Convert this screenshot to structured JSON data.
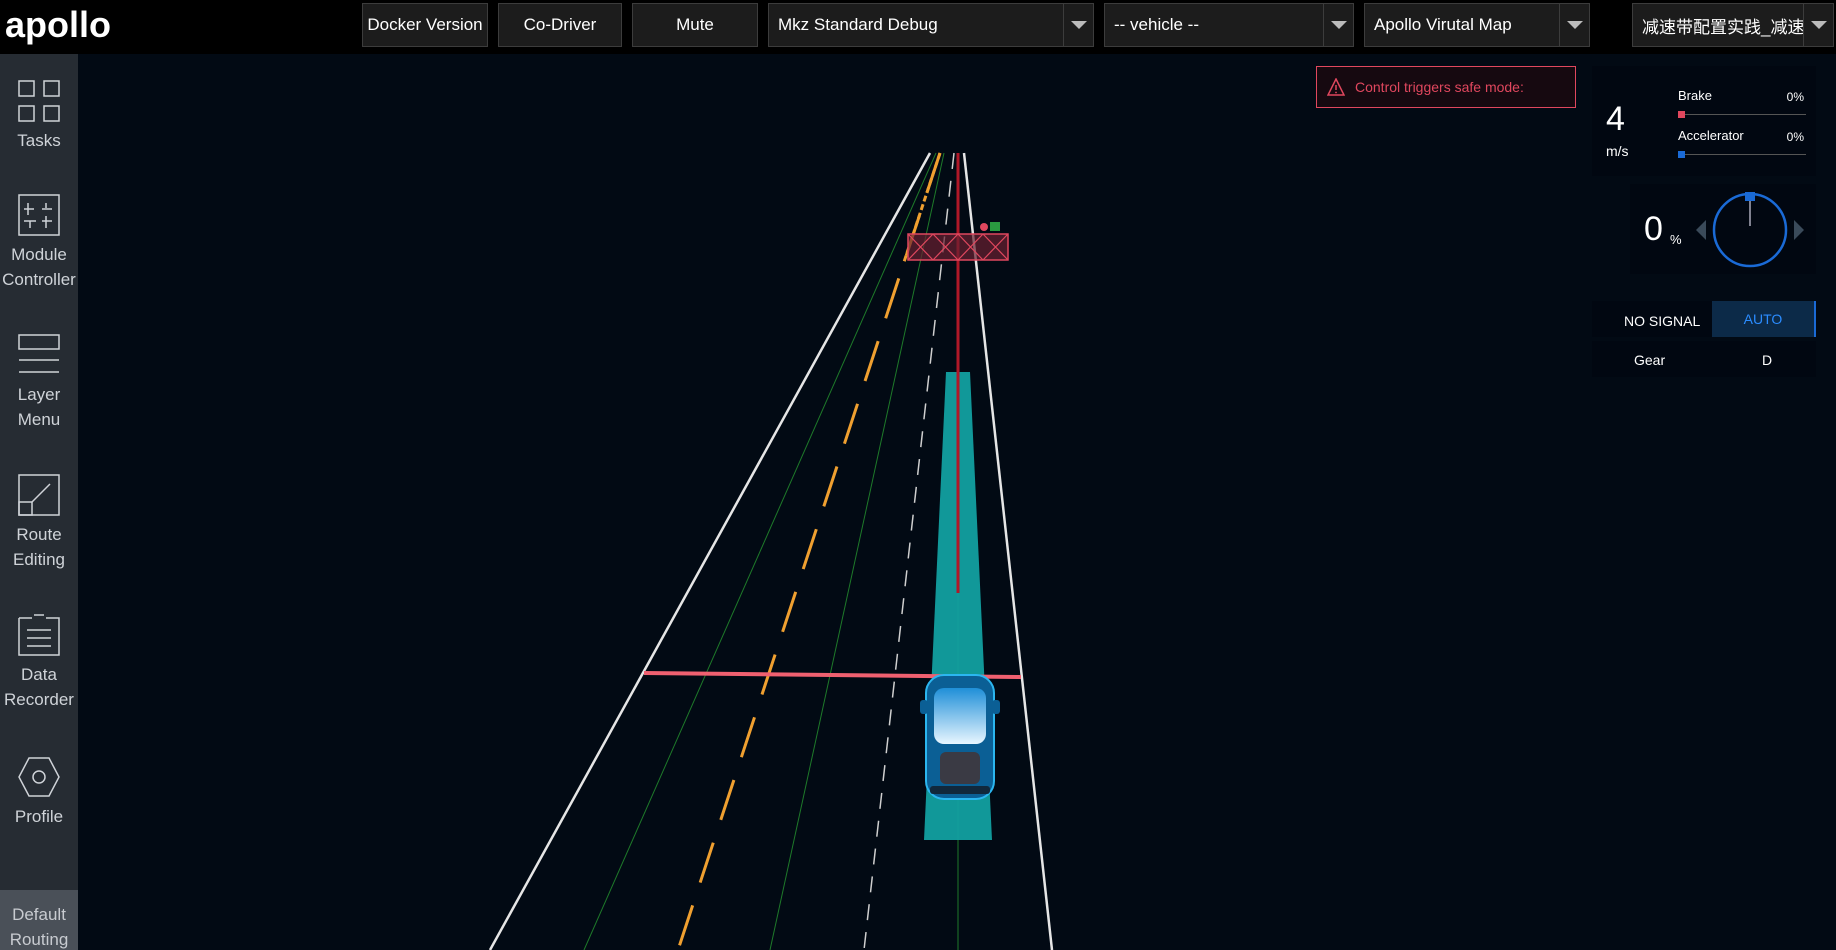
{
  "header": {
    "logo_text": "apollo",
    "buttons": {
      "docker_version": "Docker Version",
      "co_driver": "Co-Driver",
      "mute": "Mute"
    },
    "selects": {
      "mode": "Mkz Standard Debug",
      "vehicle": "-- vehicle --",
      "map": "Apollo Virutal Map",
      "scenario": "减速带配置实践_减速带"
    }
  },
  "sidebar": {
    "items": [
      {
        "label": "Tasks",
        "icon": "grid-icon"
      },
      {
        "label": "Module Controller",
        "icon": "sliders-icon"
      },
      {
        "label": "Layer Menu",
        "icon": "layers-icon"
      },
      {
        "label": "Route Editing",
        "icon": "route-icon"
      },
      {
        "label": "Data Recorder",
        "icon": "document-icon"
      },
      {
        "label": "Profile",
        "icon": "hexagon-icon"
      }
    ],
    "bottom_item": "Default Routing"
  },
  "alert": {
    "text": "Control triggers safe mode:",
    "color": "#e0475e",
    "icon": "warning-icon"
  },
  "dashboard": {
    "speed_value": "4",
    "speed_unit": "m/s",
    "brake_label": "Brake",
    "brake_value": "0%",
    "brake_level": 0,
    "brake_color": "#e0475e",
    "accelerator_label": "Accelerator",
    "accelerator_value": "0%",
    "accelerator_level": 0,
    "accelerator_color": "#1a6ad6",
    "steering_value": "0",
    "steering_unit": "%",
    "signal_text": "NO SIGNAL",
    "drive_mode": "AUTO",
    "gear_label": "Gear",
    "gear_value": "D"
  },
  "colors": {
    "background": "#020a14",
    "trajectory": "#12a0a0",
    "lane_yellow": "#f0a030",
    "lane_white": "#e6e6e6",
    "stop_line": "#f06070",
    "accent_blue": "#1a6ad6"
  }
}
